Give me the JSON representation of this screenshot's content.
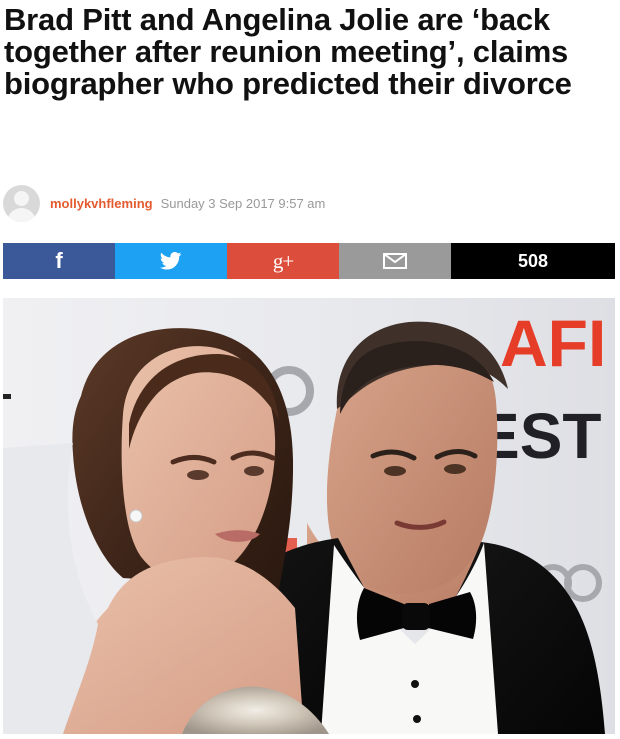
{
  "article": {
    "headline": "Brad Pitt and Angelina Jolie are ‘back together after reunion meeting’, claims biographer who predicted their divorce",
    "author": "mollykvhfleming",
    "timestamp": "Sunday 3 Sep 2017 9:57 am"
  },
  "share": {
    "facebook": {
      "icon": "facebook-icon",
      "label": "f",
      "color": "#3b5998"
    },
    "twitter": {
      "icon": "twitter-icon",
      "color": "#1da1f2"
    },
    "gplus": {
      "icon": "google-plus-icon",
      "label": "g+",
      "color": "#dc4e3b"
    },
    "email": {
      "icon": "email-icon",
      "color": "#9a9a9a"
    },
    "count": "508"
  },
  "photo": {
    "backdrop_text": {
      "logo_top": "AFI",
      "logo_bottom": "EST"
    }
  }
}
